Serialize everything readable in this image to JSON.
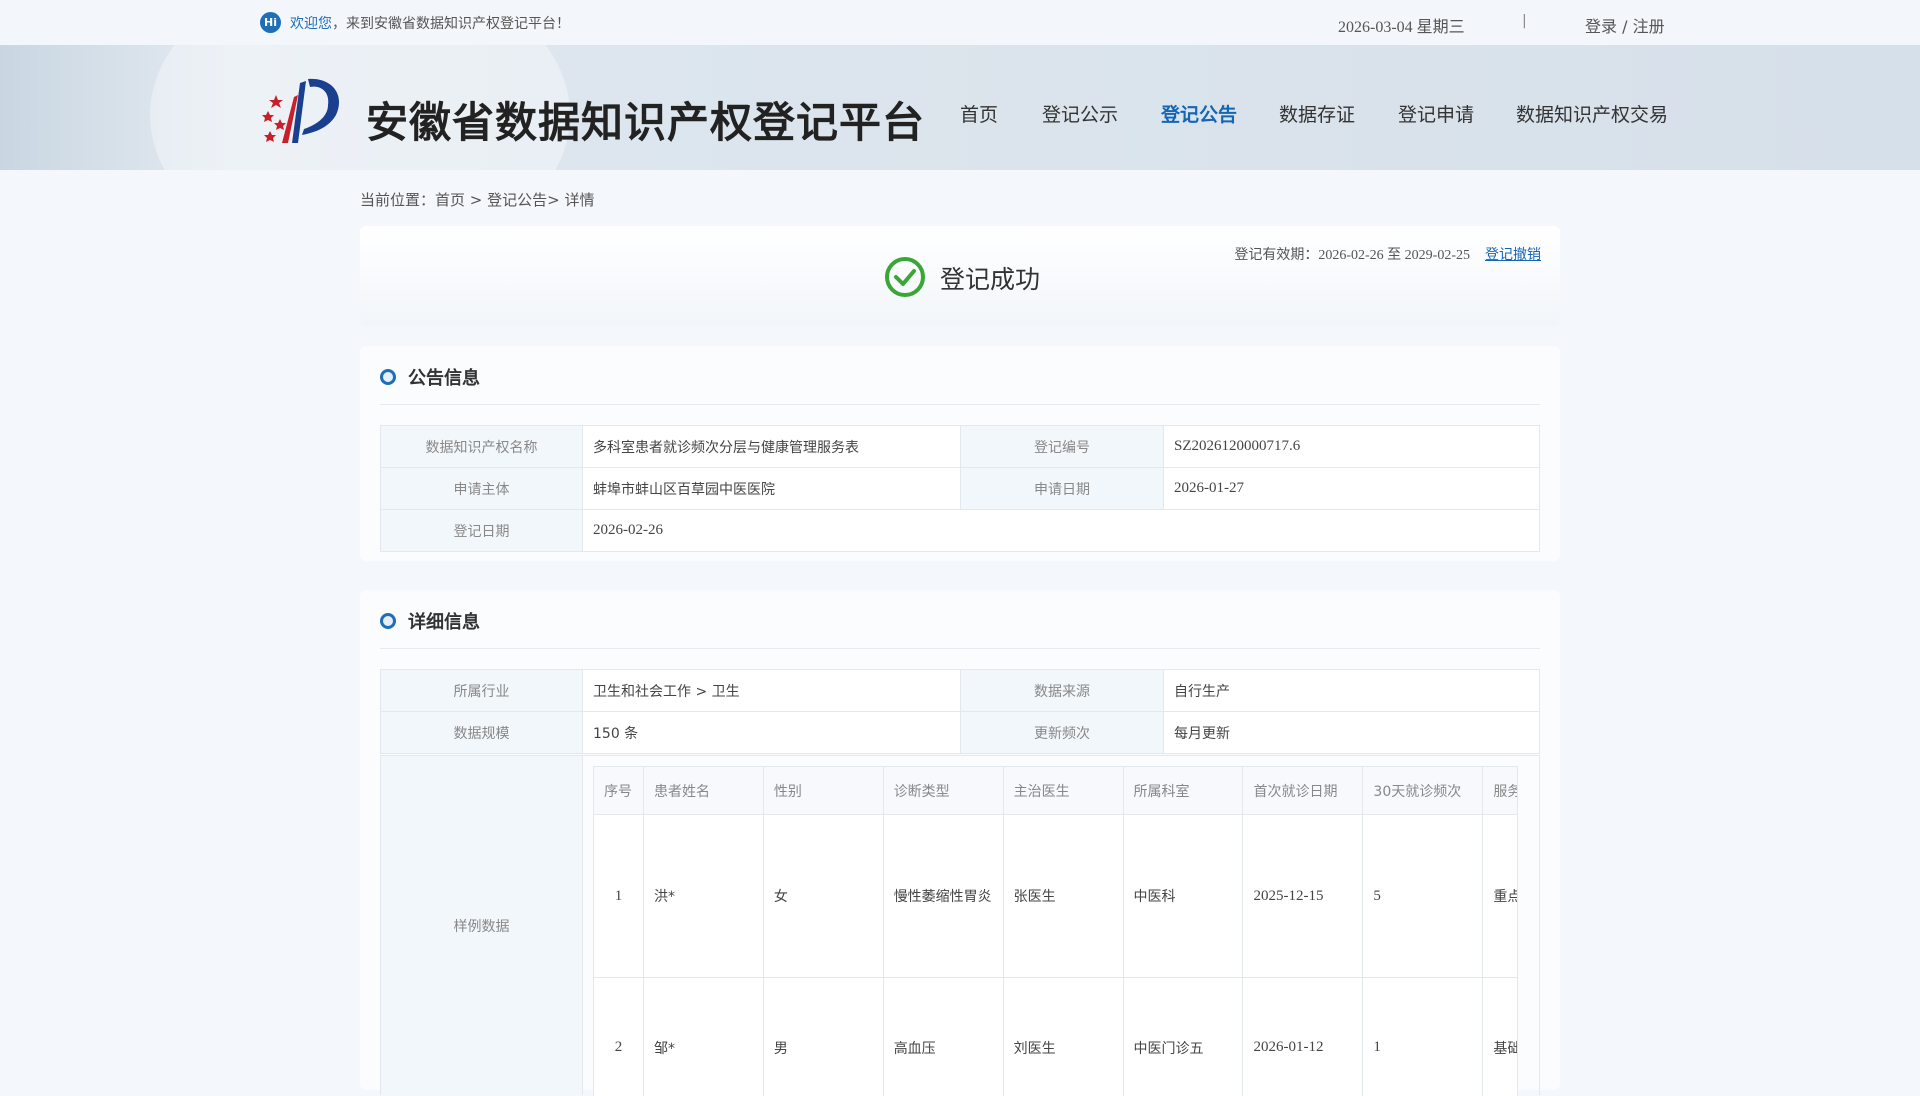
{
  "topbar": {
    "hi_badge": "Hi",
    "welcome_highlight": "欢迎您",
    "welcome_rest": "，来到安徽省数据知识产权登记平台！",
    "date": "2026-03-04 星期三",
    "separator": "|",
    "login": "登录 / 注册"
  },
  "header": {
    "site_title": "安徽省数据知识产权登记平台",
    "nav": [
      "首页",
      "登记公示",
      "登记公告",
      "数据存证",
      "登记申请",
      "数据知识产权交易"
    ],
    "active_nav": "登记公告"
  },
  "breadcrumb": "当前位置：首页 > 登记公告> 详情",
  "status": {
    "title": "登记成功",
    "validity": "登记有效期：2026-02-26 至 2029-02-25",
    "revoke": "登记撤销"
  },
  "announcement": {
    "heading": "公告信息",
    "labels": {
      "name": "数据知识产权名称",
      "reg_no": "登记编号",
      "applicant": "申请主体",
      "apply_date": "申请日期",
      "reg_date": "登记日期"
    },
    "values": {
      "name": "多科室患者就诊频次分层与健康管理服务表",
      "reg_no": "SZ2026120000717.6",
      "applicant": "蚌埠市蚌山区百草园中医医院",
      "apply_date": "2026-01-27",
      "reg_date": "2026-02-26"
    }
  },
  "detail": {
    "heading": "详细信息",
    "labels": {
      "industry": "所属行业",
      "source": "数据来源",
      "scale": "数据规模",
      "frequency": "更新频次",
      "sample": "样例数据"
    },
    "values": {
      "industry": "卫生和社会工作 > 卫生",
      "source": "自行生产",
      "scale": "150 条",
      "frequency": "每月更新"
    },
    "sample_columns": [
      "序号",
      "患者姓名",
      "性别",
      "诊断类型",
      "主治医生",
      "所属科室",
      "首次就诊日期",
      "30天就诊频次",
      "服务"
    ],
    "sample_rows": [
      [
        "1",
        "洪*",
        "女",
        "慢性萎缩性胃炎",
        "张医生",
        "中医科",
        "2025-12-15",
        "5",
        "重点"
      ],
      [
        "2",
        "邹*",
        "男",
        "高血压",
        "刘医生",
        "中医门诊五",
        "2026-01-12",
        "1",
        "基础"
      ]
    ]
  },
  "colors": {
    "accent": "#1565b5",
    "success": "#3aa635",
    "label_bg": "#f2f7fc"
  }
}
